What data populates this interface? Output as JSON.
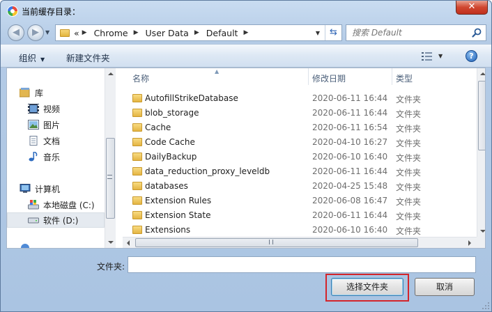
{
  "window": {
    "title": "当前缓存目录：",
    "close_label": "✕"
  },
  "address": {
    "prefix": "«",
    "crumbs": [
      "Chrome",
      "User Data",
      "Default"
    ],
    "search_placeholder": "搜索 Default"
  },
  "toolbar": {
    "organize_label": "组织",
    "new_folder_label": "新建文件夹",
    "help_label": "?"
  },
  "sidebar": {
    "groups": [
      {
        "label": "库",
        "items": [
          "视频",
          "图片",
          "文档",
          "音乐"
        ]
      },
      {
        "label": "计算机",
        "items": [
          "本地磁盘 (C:)",
          "软件 (D:)"
        ]
      }
    ],
    "selected": "软件 (D:)"
  },
  "columns": {
    "name": "名称",
    "modified": "修改日期",
    "type": "类型"
  },
  "files": [
    {
      "name": "AutofillStrikeDatabase",
      "modified": "2020-06-11 16:44",
      "type": "文件夹"
    },
    {
      "name": "blob_storage",
      "modified": "2020-06-11 16:44",
      "type": "文件夹"
    },
    {
      "name": "Cache",
      "modified": "2020-06-11 16:54",
      "type": "文件夹"
    },
    {
      "name": "Code Cache",
      "modified": "2020-04-10 16:27",
      "type": "文件夹"
    },
    {
      "name": "DailyBackup",
      "modified": "2020-06-10 16:40",
      "type": "文件夹"
    },
    {
      "name": "data_reduction_proxy_leveldb",
      "modified": "2020-06-11 16:44",
      "type": "文件夹"
    },
    {
      "name": "databases",
      "modified": "2020-04-25 15:48",
      "type": "文件夹"
    },
    {
      "name": "Extension Rules",
      "modified": "2020-06-08 16:47",
      "type": "文件夹"
    },
    {
      "name": "Extension State",
      "modified": "2020-06-11 16:44",
      "type": "文件夹"
    },
    {
      "name": "Extensions",
      "modified": "2020-06-10 16:40",
      "type": "文件夹"
    }
  ],
  "footer": {
    "folder_label": "文件夹:",
    "folder_value": "",
    "select_button": "选择文件夹",
    "cancel_button": "取消"
  },
  "colors": {
    "highlight": "#d4242a",
    "title_bar": "#b4cbe6",
    "folder": "#e4b543"
  }
}
